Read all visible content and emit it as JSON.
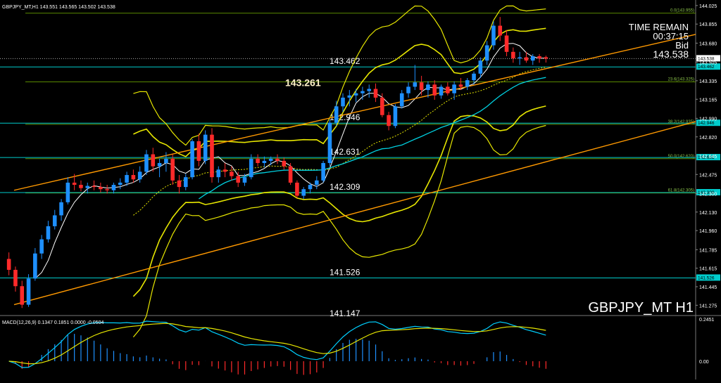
{
  "header": {
    "ohlc_text": "GBPJPY_MT,H1  143.551 143.565 143.502 143.538",
    "macd_text": "MACD(12,26,9) 0.1347 0.1851 0.0000 -0.0504"
  },
  "overlay": {
    "time_remain_label": "TIME REMAIN",
    "time_remain_value": "00:37:15",
    "bid_label": "Bid",
    "bid_value": "143.538",
    "symbol_label": "GBPJPY_MT H1"
  },
  "chart_data": {
    "type": "candlestick",
    "symbol": "GBPJPY_MT",
    "timeframe": "H1",
    "ylim": [
      141.2,
      144.05
    ],
    "y_ticks": [
      144.025,
      143.855,
      143.68,
      143.505,
      143.335,
      143.165,
      142.99,
      142.82,
      142.645,
      142.475,
      142.3,
      142.13,
      141.96,
      141.785,
      141.615,
      141.445,
      141.275
    ],
    "price_box": "143.538",
    "level_tag": "143.462",
    "levels": [
      {
        "label": "143.462",
        "price": 143.462,
        "tag": "143.462"
      },
      {
        "label": "143.261",
        "price": 143.261,
        "tag": ""
      },
      {
        "label": "142.946",
        "price": 142.946,
        "tag": "142.946"
      },
      {
        "label": "142.631",
        "price": 142.631,
        "tag": "142.631"
      },
      {
        "label": "142.309",
        "price": 142.309,
        "tag": "142.309"
      },
      {
        "label": "141.526",
        "price": 141.526,
        "tag": "141.526"
      },
      {
        "label": "141.147",
        "price": 141.147,
        "tag": ""
      }
    ],
    "fibonacci": [
      {
        "label": "0.0(143.955)",
        "price": 143.955
      },
      {
        "label": "23.6(143.325)",
        "price": 143.325
      },
      {
        "label": "38.2(142.935)",
        "price": 142.935
      },
      {
        "label": "50.0(142.620)",
        "price": 142.62
      },
      {
        "label": "61.8(142.305)",
        "price": 142.305
      }
    ],
    "candles": [
      {
        "o": 141.7,
        "h": 141.76,
        "l": 141.55,
        "c": 141.6
      },
      {
        "o": 141.6,
        "h": 141.63,
        "l": 141.4,
        "c": 141.45
      },
      {
        "o": 141.45,
        "h": 141.5,
        "l": 141.25,
        "c": 141.28
      },
      {
        "o": 141.28,
        "h": 141.56,
        "l": 141.26,
        "c": 141.52
      },
      {
        "o": 141.52,
        "h": 141.8,
        "l": 141.5,
        "c": 141.75
      },
      {
        "o": 141.75,
        "h": 141.92,
        "l": 141.7,
        "c": 141.88
      },
      {
        "o": 141.88,
        "h": 142.05,
        "l": 141.85,
        "c": 142.0
      },
      {
        "o": 142.0,
        "h": 142.15,
        "l": 141.97,
        "c": 142.1
      },
      {
        "o": 142.1,
        "h": 142.25,
        "l": 142.05,
        "c": 142.22
      },
      {
        "o": 142.22,
        "h": 142.45,
        "l": 142.2,
        "c": 142.4
      },
      {
        "o": 142.4,
        "h": 142.48,
        "l": 142.33,
        "c": 142.38
      },
      {
        "o": 142.38,
        "h": 142.42,
        "l": 142.32,
        "c": 142.35
      },
      {
        "o": 142.35,
        "h": 142.4,
        "l": 142.3,
        "c": 142.37
      },
      {
        "o": 142.37,
        "h": 142.42,
        "l": 142.33,
        "c": 142.36
      },
      {
        "o": 142.36,
        "h": 142.4,
        "l": 142.31,
        "c": 142.34
      },
      {
        "o": 142.34,
        "h": 142.38,
        "l": 142.3,
        "c": 142.33
      },
      {
        "o": 142.33,
        "h": 142.4,
        "l": 142.3,
        "c": 142.38
      },
      {
        "o": 142.38,
        "h": 142.44,
        "l": 142.34,
        "c": 142.4
      },
      {
        "o": 142.4,
        "h": 142.5,
        "l": 142.37,
        "c": 142.47
      },
      {
        "o": 142.47,
        "h": 142.52,
        "l": 142.4,
        "c": 142.43
      },
      {
        "o": 142.43,
        "h": 142.55,
        "l": 142.4,
        "c": 142.5
      },
      {
        "o": 142.5,
        "h": 142.7,
        "l": 142.47,
        "c": 142.66
      },
      {
        "o": 142.66,
        "h": 142.72,
        "l": 142.5,
        "c": 142.55
      },
      {
        "o": 142.55,
        "h": 142.62,
        "l": 142.45,
        "c": 142.58
      },
      {
        "o": 142.58,
        "h": 142.68,
        "l": 142.5,
        "c": 142.62
      },
      {
        "o": 142.62,
        "h": 142.66,
        "l": 142.38,
        "c": 142.42
      },
      {
        "o": 142.42,
        "h": 142.47,
        "l": 142.3,
        "c": 142.36
      },
      {
        "o": 142.36,
        "h": 142.48,
        "l": 142.33,
        "c": 142.45
      },
      {
        "o": 142.45,
        "h": 142.8,
        "l": 142.43,
        "c": 142.78
      },
      {
        "o": 142.78,
        "h": 142.85,
        "l": 142.55,
        "c": 142.6
      },
      {
        "o": 142.6,
        "h": 142.88,
        "l": 142.57,
        "c": 142.84
      },
      {
        "o": 142.84,
        "h": 142.9,
        "l": 142.4,
        "c": 142.45
      },
      {
        "o": 142.45,
        "h": 142.55,
        "l": 142.4,
        "c": 142.52
      },
      {
        "o": 142.52,
        "h": 142.58,
        "l": 142.45,
        "c": 142.5
      },
      {
        "o": 142.5,
        "h": 142.55,
        "l": 142.42,
        "c": 142.46
      },
      {
        "o": 142.46,
        "h": 142.5,
        "l": 142.36,
        "c": 142.4
      },
      {
        "o": 142.4,
        "h": 142.48,
        "l": 142.37,
        "c": 142.45
      },
      {
        "o": 142.45,
        "h": 142.66,
        "l": 142.43,
        "c": 142.62
      },
      {
        "o": 142.62,
        "h": 142.66,
        "l": 142.55,
        "c": 142.58
      },
      {
        "o": 142.58,
        "h": 142.64,
        "l": 142.54,
        "c": 142.6
      },
      {
        "o": 142.6,
        "h": 142.64,
        "l": 142.56,
        "c": 142.62
      },
      {
        "o": 142.62,
        "h": 142.66,
        "l": 142.57,
        "c": 142.6
      },
      {
        "o": 142.6,
        "h": 142.63,
        "l": 142.52,
        "c": 142.55
      },
      {
        "o": 142.55,
        "h": 142.58,
        "l": 142.38,
        "c": 142.4
      },
      {
        "o": 142.4,
        "h": 142.42,
        "l": 142.26,
        "c": 142.28
      },
      {
        "o": 142.28,
        "h": 142.36,
        "l": 142.25,
        "c": 142.34
      },
      {
        "o": 142.34,
        "h": 142.4,
        "l": 142.3,
        "c": 142.38
      },
      {
        "o": 142.38,
        "h": 142.46,
        "l": 142.34,
        "c": 142.42
      },
      {
        "o": 142.42,
        "h": 142.6,
        "l": 142.4,
        "c": 142.58
      },
      {
        "o": 142.58,
        "h": 142.98,
        "l": 142.55,
        "c": 142.95
      },
      {
        "o": 142.95,
        "h": 143.15,
        "l": 142.92,
        "c": 143.1
      },
      {
        "o": 143.1,
        "h": 143.22,
        "l": 143.05,
        "c": 143.18
      },
      {
        "o": 143.18,
        "h": 143.25,
        "l": 143.1,
        "c": 143.2
      },
      {
        "o": 143.2,
        "h": 143.26,
        "l": 143.14,
        "c": 143.22
      },
      {
        "o": 143.22,
        "h": 143.28,
        "l": 143.16,
        "c": 143.24
      },
      {
        "o": 143.24,
        "h": 143.3,
        "l": 143.18,
        "c": 143.26
      },
      {
        "o": 143.26,
        "h": 143.31,
        "l": 143.14,
        "c": 143.18
      },
      {
        "o": 143.18,
        "h": 143.22,
        "l": 143.0,
        "c": 143.02
      },
      {
        "o": 143.02,
        "h": 143.05,
        "l": 142.88,
        "c": 142.92
      },
      {
        "o": 142.92,
        "h": 143.12,
        "l": 142.9,
        "c": 143.1
      },
      {
        "o": 143.1,
        "h": 143.25,
        "l": 143.08,
        "c": 143.22
      },
      {
        "o": 143.22,
        "h": 143.32,
        "l": 143.18,
        "c": 143.28
      },
      {
        "o": 143.28,
        "h": 143.48,
        "l": 143.25,
        "c": 143.32
      },
      {
        "o": 143.32,
        "h": 143.38,
        "l": 143.2,
        "c": 143.25
      },
      {
        "o": 143.25,
        "h": 143.33,
        "l": 143.18,
        "c": 143.3
      },
      {
        "o": 143.3,
        "h": 143.34,
        "l": 143.16,
        "c": 143.2
      },
      {
        "o": 143.2,
        "h": 143.3,
        "l": 143.17,
        "c": 143.28
      },
      {
        "o": 143.28,
        "h": 143.32,
        "l": 143.2,
        "c": 143.22
      },
      {
        "o": 143.22,
        "h": 143.33,
        "l": 143.16,
        "c": 143.3
      },
      {
        "o": 143.3,
        "h": 143.36,
        "l": 143.25,
        "c": 143.28
      },
      {
        "o": 143.28,
        "h": 143.36,
        "l": 143.25,
        "c": 143.34
      },
      {
        "o": 143.34,
        "h": 143.42,
        "l": 143.3,
        "c": 143.4
      },
      {
        "o": 143.4,
        "h": 143.55,
        "l": 143.36,
        "c": 143.52
      },
      {
        "o": 143.52,
        "h": 143.7,
        "l": 143.48,
        "c": 143.66
      },
      {
        "o": 143.66,
        "h": 143.88,
        "l": 143.62,
        "c": 143.84
      },
      {
        "o": 143.84,
        "h": 143.92,
        "l": 143.7,
        "c": 143.75
      },
      {
        "o": 143.75,
        "h": 143.8,
        "l": 143.56,
        "c": 143.6
      },
      {
        "o": 143.6,
        "h": 143.64,
        "l": 143.5,
        "c": 143.54
      },
      {
        "o": 143.54,
        "h": 143.6,
        "l": 143.48,
        "c": 143.55
      },
      {
        "o": 143.55,
        "h": 143.6,
        "l": 143.5,
        "c": 143.52
      },
      {
        "o": 143.52,
        "h": 143.58,
        "l": 143.48,
        "c": 143.56
      },
      {
        "o": 143.56,
        "h": 143.58,
        "l": 143.5,
        "c": 143.54
      },
      {
        "o": 143.551,
        "h": 143.565,
        "l": 143.502,
        "c": 143.538
      }
    ],
    "macd": {
      "label": "MACD(12,26,9)",
      "values": [
        0.1347,
        0.1851,
        0.0,
        -0.0504
      ],
      "ylim": [
        -0.09,
        0.2451
      ],
      "y_ticks": [
        0.2451,
        0.0
      ]
    }
  },
  "colors": {
    "background": "#000000",
    "bull": "#1e90ff",
    "bear": "#ff2a2a",
    "bands": "#e6e600",
    "level_lines": "#00cccc",
    "fib": "#4caf50",
    "trendline": "#ff9900",
    "macd_line": "#00d0ff",
    "signal_line": "#e6e600"
  }
}
